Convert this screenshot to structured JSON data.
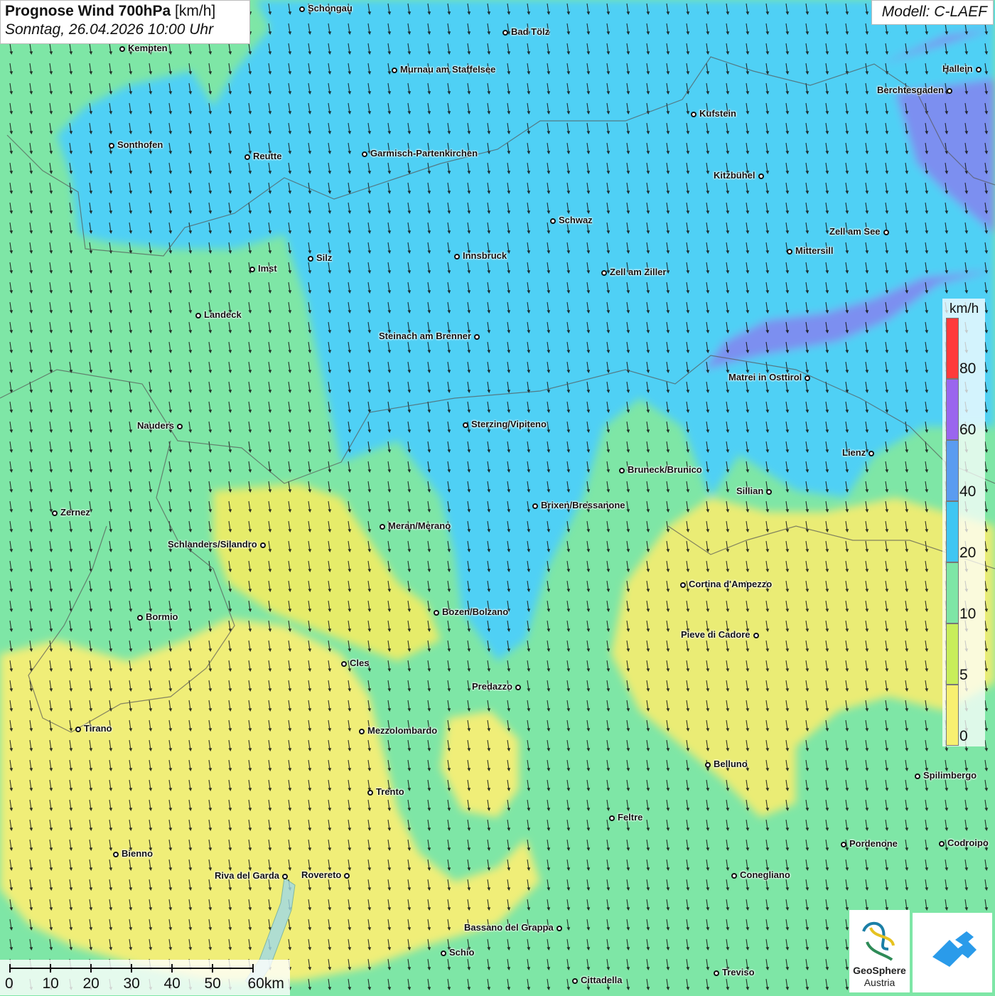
{
  "header": {
    "title_bold": "Prognose Wind 700hPa",
    "title_unit": "[km/h]",
    "subtitle": "Sonntag, 26.04.2026 10:00 Uhr",
    "model": "Modell: C-LAEF"
  },
  "legend": {
    "unit": "km/h",
    "ticks": [
      "80",
      "60",
      "40",
      "20",
      "10",
      "5",
      "0"
    ],
    "colors": [
      "#ff3b3b",
      "#9a66ee",
      "#5a9cf0",
      "#3fc6f2",
      "#7ee6a6",
      "#c8ee5a",
      "#f8f070"
    ]
  },
  "colors": {
    "calm": "#f8f070",
    "light": "#c8ee5a",
    "moderate": "#7ee6a6",
    "fresh": "#4fd0f5",
    "strong": "#5a9cf0",
    "very_strong": "#8a80ee"
  },
  "scalebar": {
    "labels": [
      "0",
      "10",
      "20",
      "30",
      "40",
      "50",
      "60km"
    ]
  },
  "logos": {
    "geosphere_line1": "GeoSphere",
    "geosphere_line2": "Austria"
  },
  "cities": [
    {
      "name": "Schongau"
    },
    {
      "name": "Bad Tölz"
    },
    {
      "name": "Kempten"
    },
    {
      "name": "Murnau am Staffelsee"
    },
    {
      "name": "Hallein"
    },
    {
      "name": "Berchtesgaden"
    },
    {
      "name": "Kufstein"
    },
    {
      "name": "Sonthofen"
    },
    {
      "name": "Reutte"
    },
    {
      "name": "Garmisch-Partenkirchen"
    },
    {
      "name": "Kitzbühel"
    },
    {
      "name": "Schwaz"
    },
    {
      "name": "Zell am See"
    },
    {
      "name": "Innsbruck"
    },
    {
      "name": "Silz"
    },
    {
      "name": "Imst"
    },
    {
      "name": "Mittersill"
    },
    {
      "name": "Zell am Ziller"
    },
    {
      "name": "Landeck"
    },
    {
      "name": "Steinach am Brenner"
    },
    {
      "name": "Matrei in Osttirol"
    },
    {
      "name": "Nauders"
    },
    {
      "name": "Sterzing/Vipiteno"
    },
    {
      "name": "Lienz"
    },
    {
      "name": "Bruneck/Brunico"
    },
    {
      "name": "Sillian"
    },
    {
      "name": "Brixen/Bressanone"
    },
    {
      "name": "Zernez"
    },
    {
      "name": "Meran/Merano"
    },
    {
      "name": "Schlanders/Silandro"
    },
    {
      "name": "Cortina d'Ampezzo"
    },
    {
      "name": "Bozen/Bolzano"
    },
    {
      "name": "Bormio"
    },
    {
      "name": "Pieve di Cadore"
    },
    {
      "name": "Cles"
    },
    {
      "name": "Predazzo"
    },
    {
      "name": "Tirano"
    },
    {
      "name": "Mezzolombardo"
    },
    {
      "name": "Belluno"
    },
    {
      "name": "Spilimbergo"
    },
    {
      "name": "Trento"
    },
    {
      "name": "Feltre"
    },
    {
      "name": "Bienno"
    },
    {
      "name": "Pordenone"
    },
    {
      "name": "Codroipo"
    },
    {
      "name": "Riva del Garda"
    },
    {
      "name": "Rovereto"
    },
    {
      "name": "Conegliano"
    },
    {
      "name": "Bassano del Grappa"
    },
    {
      "name": "Schio"
    },
    {
      "name": "Treviso"
    },
    {
      "name": "Cittadella"
    }
  ]
}
